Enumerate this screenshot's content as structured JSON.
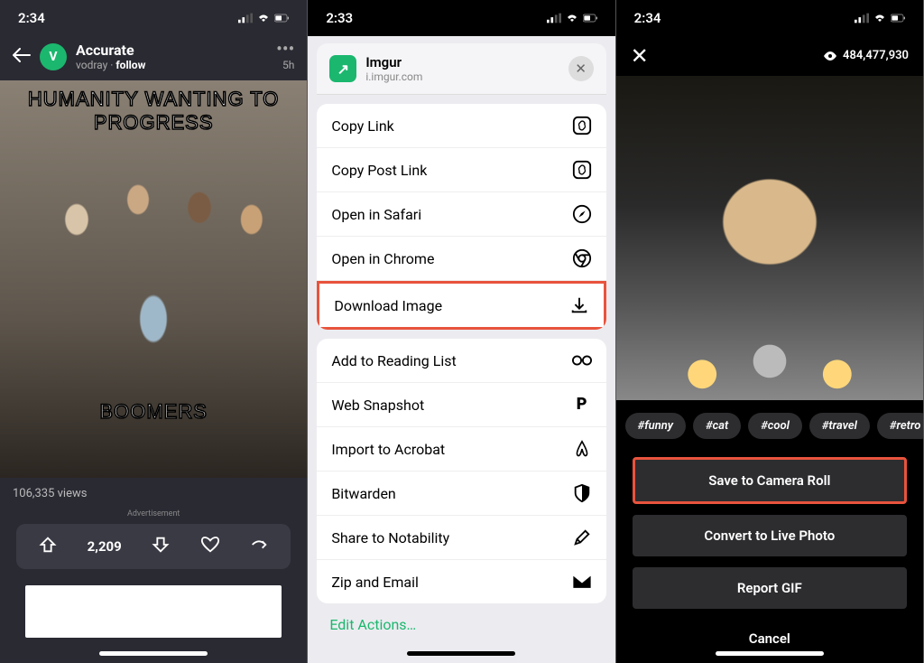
{
  "phone1": {
    "time": "2:34",
    "title": "Accurate",
    "username": "vodray",
    "follow": "follow",
    "age": "5h",
    "meme_top": "HUMANITY WANTING TO PROGRESS",
    "meme_bottom": "BOOMERS",
    "views": "106,335 views",
    "ad_label": "Advertisement",
    "score": "2,209"
  },
  "phone2": {
    "time": "2:33",
    "app_name": "Imgur",
    "app_domain": "i.imgur.com",
    "group1": [
      "Copy Link",
      "Copy Post Link",
      "Open in Safari",
      "Open in Chrome",
      "Download Image"
    ],
    "group2": [
      "Add to Reading List",
      "Web Snapshot",
      "Import to Acrobat",
      "Bitwarden",
      "Share to Notability",
      "Zip and Email"
    ],
    "edit_actions": "Edit Actions…"
  },
  "phone3": {
    "time": "2:34",
    "view_count": "484,477,930",
    "tags": [
      "#funny",
      "#cat",
      "#cool",
      "#travel",
      "#retro"
    ],
    "btn_save": "Save to Camera Roll",
    "btn_convert": "Convert to Live Photo",
    "btn_report": "Report GIF",
    "cancel": "Cancel"
  }
}
